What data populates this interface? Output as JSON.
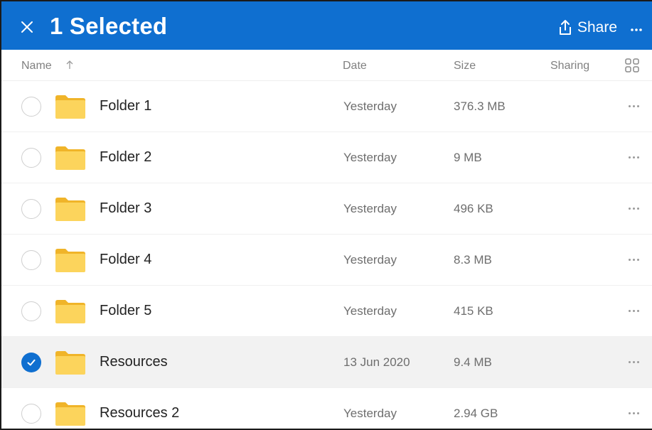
{
  "header": {
    "title": "1 Selected",
    "share_label": "Share",
    "accent": "#0f6fd0"
  },
  "columns": {
    "name": "Name",
    "date": "Date",
    "size": "Size",
    "sharing": "Sharing"
  },
  "rows": [
    {
      "name": "Folder 1",
      "date": "Yesterday",
      "size": "376.3 MB",
      "selected": false
    },
    {
      "name": "Folder 2",
      "date": "Yesterday",
      "size": "9 MB",
      "selected": false
    },
    {
      "name": "Folder 3",
      "date": "Yesterday",
      "size": "496 KB",
      "selected": false
    },
    {
      "name": "Folder 4",
      "date": "Yesterday",
      "size": "8.3 MB",
      "selected": false
    },
    {
      "name": "Folder 5",
      "date": "Yesterday",
      "size": "415 KB",
      "selected": false
    },
    {
      "name": "Resources",
      "date": "13 Jun 2020",
      "size": "9.4 MB",
      "selected": true
    },
    {
      "name": "Resources 2",
      "date": "Yesterday",
      "size": "2.94 GB",
      "selected": false
    }
  ],
  "icons": {
    "close": "close-icon",
    "share": "share-icon",
    "more": "more-horizontal-icon",
    "sort": "sort-ascending-icon",
    "view": "grid-view-icon",
    "folder": "folder-icon",
    "checkmark": "checkmark-icon"
  }
}
